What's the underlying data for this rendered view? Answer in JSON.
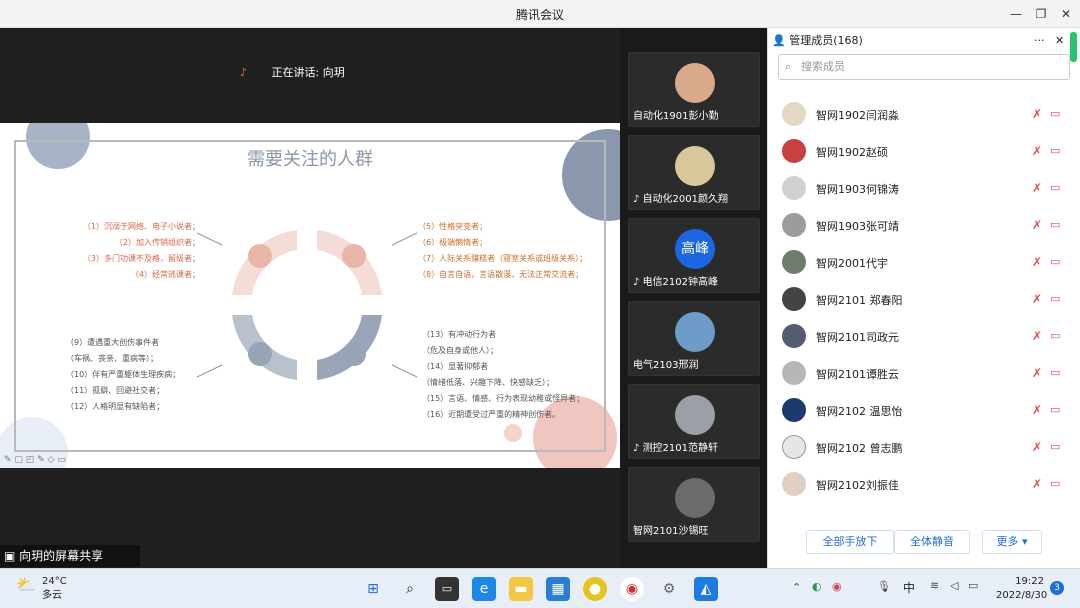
{
  "window": {
    "title": "腾讯会议"
  },
  "stage": {
    "speaking_label": "正在讲话: 向玥",
    "share_label": "向玥的屏幕共享"
  },
  "slide": {
    "title": "需要关注的人群",
    "top_left": [
      "（1）沉溺于网络、电子小说者；",
      "（2）加入传销组织者；",
      "（3）多门功课不及格，留级者；",
      "（4）经常逃课者；"
    ],
    "top_right": [
      "（5）性格突变者；",
      "（6）极端懒惰者；",
      "（7）人际关系赚糕者（寝室关系或班级关系）；",
      "（8）自言自语，言语散漫，无法正常交流者；"
    ],
    "bottom_left": [
      "（9）遭遇重大创伤事件者",
      "（车祸、丧亲、重病等）；",
      "（10）伴有严重躯体生理疾病；",
      "（11）孤僻、回避社交者；",
      "（12）人格明显有缺陷者；"
    ],
    "bottom_right": [
      "（13）有冲动行为者",
      "（危及自身或他人）；",
      "（14）显著抑郁者",
      "（情绪低落、兴趣下降、快感缺乏）；",
      "（15）言语、情感、行为表现幼稚或怪异者；",
      "（16）近期遭受过严重的精神创伤者。"
    ]
  },
  "videos": [
    {
      "name": "自动化1901彭小勤",
      "color": "#d9a98a"
    },
    {
      "name": "自动化2001颜久翔",
      "color": "#d6c89a"
    },
    {
      "name": "电信2102钟高峰",
      "color": "#1e66e0",
      "avatar_text": "高峰"
    },
    {
      "name": "电气2103邢润",
      "color": "#6d9cc9"
    },
    {
      "name": "测控2101范静轩",
      "color": "#9aa0a6"
    },
    {
      "name": "智网2101沙锡旺",
      "color": "#6b6b6b"
    }
  ],
  "panel": {
    "header": "管理成员(168)",
    "search_placeholder": "搜索成员",
    "members": [
      {
        "name": "智网1902闫润淼",
        "color": "#e4d7c3"
      },
      {
        "name": "智网1902赵硕",
        "color": "#c94040"
      },
      {
        "name": "智网1903何锦涛",
        "color": "#d0d0d0"
      },
      {
        "name": "智网1903张可靖",
        "color": "#9c9c9c"
      },
      {
        "name": "智网2001代宇",
        "color": "#6f7d6f"
      },
      {
        "name": "智网2101 郑春阳",
        "color": "#444"
      },
      {
        "name": "智网2101司政元",
        "color": "#555e70"
      },
      {
        "name": "智网2101谭胜云",
        "color": "#b7b7b7"
      },
      {
        "name": "智网2102   温思怡",
        "color": "#1d3a6e"
      },
      {
        "name": "智网2102 曾志鹏",
        "color": "#e6e6e6"
      },
      {
        "name": "智网2102刘振佳",
        "color": "#e0cfc0"
      }
    ],
    "buttons": {
      "raise": "全部手放下",
      "mute": "全体静音",
      "more": "更多"
    }
  },
  "taskbar": {
    "weather_temp": "24°C",
    "weather_desc": "多云",
    "ime": "中",
    "time": "19:22",
    "date": "2022/8/30",
    "notif_count": "3"
  }
}
